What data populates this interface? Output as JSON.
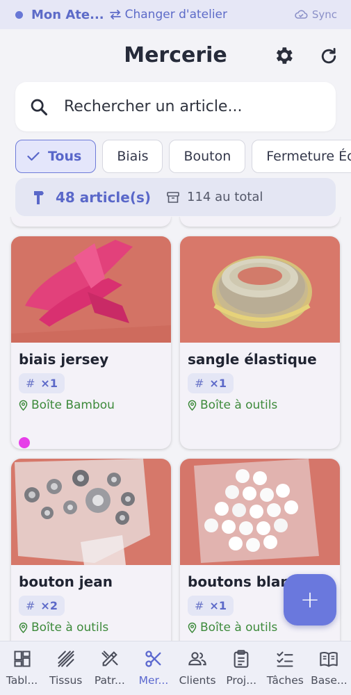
{
  "topbar": {
    "atelier_name": "Mon Ate...",
    "switch_label": "Changer d'atelier",
    "sync_label": "Sync"
  },
  "header": {
    "title": "Mercerie"
  },
  "search": {
    "placeholder": "Rechercher un article..."
  },
  "filters": [
    "Tous",
    "Biais",
    "Bouton",
    "Fermeture Éclair"
  ],
  "active_filter": "Tous",
  "summary": {
    "count": "48 article(s)",
    "total": "114 au total"
  },
  "items": [
    {
      "name": "biais jersey",
      "qty": "×1",
      "location": "Boîte Bambou",
      "color_tag": "#e63ee8"
    },
    {
      "name": "sangle élastique",
      "qty": "×1",
      "location": "Boîte à outils"
    },
    {
      "name": "bouton jean",
      "qty": "×2",
      "location": "Boîte à outils"
    },
    {
      "name": "boutons blancs",
      "qty": "×1",
      "location": "Boîte à outils"
    }
  ],
  "fab": {
    "label": "+"
  },
  "nav": [
    {
      "label": "Tabl...",
      "icon": "dashboard-icon"
    },
    {
      "label": "Tissus",
      "icon": "fabric-icon"
    },
    {
      "label": "Patr...",
      "icon": "pattern-icon"
    },
    {
      "label": "Mer...",
      "icon": "scissors-icon",
      "active": true
    },
    {
      "label": "Clients",
      "icon": "people-icon"
    },
    {
      "label": "Proj...",
      "icon": "clipboard-icon"
    },
    {
      "label": "Tâches",
      "icon": "checklist-icon"
    },
    {
      "label": "Base...",
      "icon": "book-icon"
    }
  ],
  "colors": {
    "accent": "#6a78dd",
    "location_green": "#3d8a3b",
    "bg": "#f3f3f7"
  }
}
